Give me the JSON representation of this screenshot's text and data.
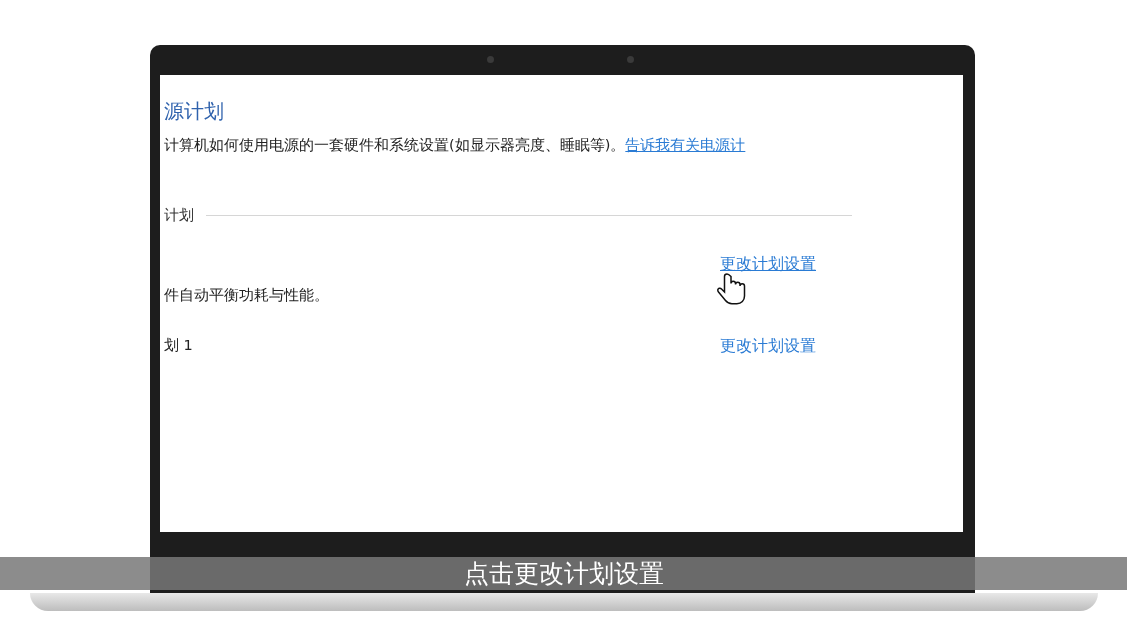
{
  "screen": {
    "title": "源计划",
    "description": "计算机如何使用电源的一套硬件和系统设置(如显示器亮度、睡眠等)。",
    "help_link": "告诉我有关电源计",
    "section_heading": "计划",
    "plans": [
      {
        "description": "件自动平衡功耗与性能。",
        "link": "更改计划设置",
        "hovered": true
      },
      {
        "name": "划 1",
        "link": "更改计划设置",
        "hovered": false
      }
    ]
  },
  "subtitle": "点击更改计划设置"
}
